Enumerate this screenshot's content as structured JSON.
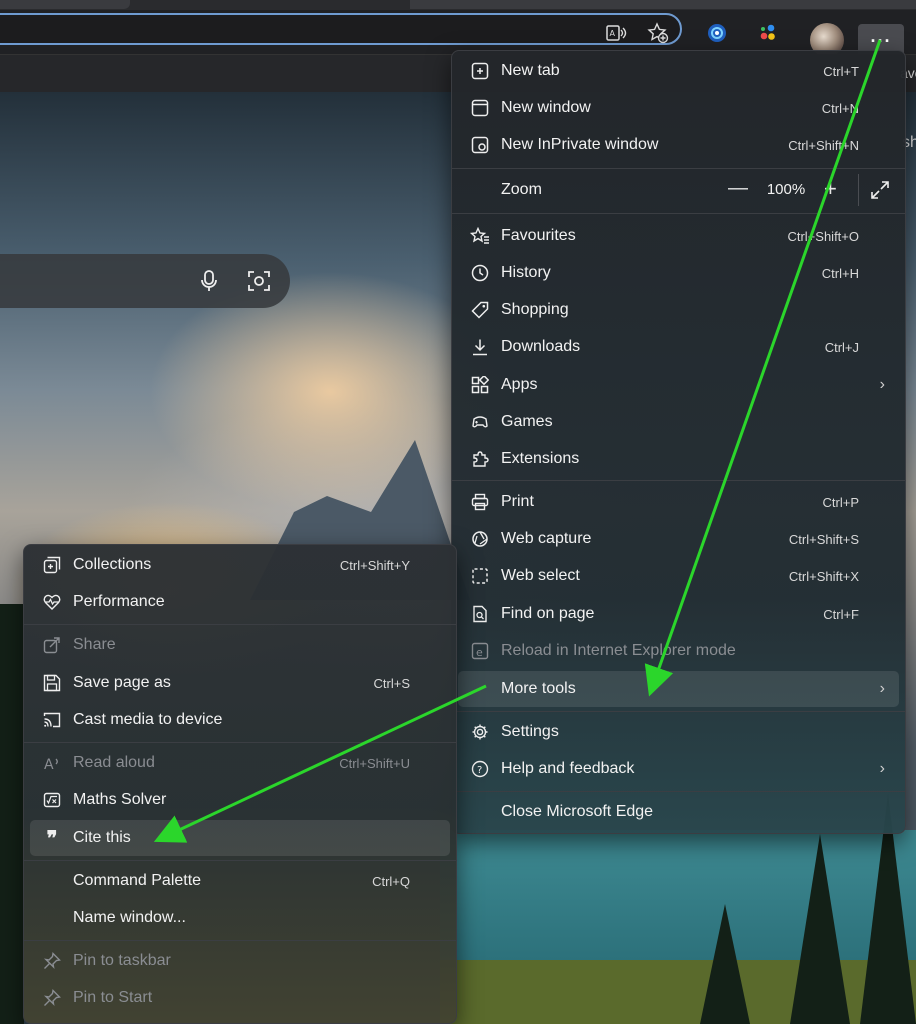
{
  "favourites_bar": {
    "partial_text": "avo"
  },
  "toolbar": {
    "more_label": "···",
    "icons": [
      "read-aloud-icon",
      "add-favourite-icon",
      "copilot-icon",
      "extensions-icon"
    ]
  },
  "page": {
    "search_icons": [
      "microphone-icon",
      "visual-search-icon"
    ],
    "right_edge_text": "sh"
  },
  "main_menu": {
    "new_tab": {
      "label": "New tab",
      "shortcut": "Ctrl+T"
    },
    "new_window": {
      "label": "New window",
      "shortcut": "Ctrl+N"
    },
    "new_inprivate": {
      "label": "New InPrivate window",
      "shortcut": "Ctrl+Shift+N"
    },
    "zoom": {
      "label": "Zoom",
      "minus": "—",
      "value": "100%",
      "plus": "+"
    },
    "favourites": {
      "label": "Favourites",
      "shortcut": "Ctrl+Shift+O"
    },
    "history": {
      "label": "History",
      "shortcut": "Ctrl+H"
    },
    "shopping": {
      "label": "Shopping"
    },
    "downloads": {
      "label": "Downloads",
      "shortcut": "Ctrl+J"
    },
    "apps": {
      "label": "Apps"
    },
    "games": {
      "label": "Games"
    },
    "extensions": {
      "label": "Extensions"
    },
    "print": {
      "label": "Print",
      "shortcut": "Ctrl+P"
    },
    "web_capture": {
      "label": "Web capture",
      "shortcut": "Ctrl+Shift+S"
    },
    "web_select": {
      "label": "Web select",
      "shortcut": "Ctrl+Shift+X"
    },
    "find_on_page": {
      "label": "Find on page",
      "shortcut": "Ctrl+F"
    },
    "reload_ie": {
      "label": "Reload in Internet Explorer mode"
    },
    "more_tools": {
      "label": "More tools"
    },
    "settings": {
      "label": "Settings"
    },
    "help_feedback": {
      "label": "Help and feedback"
    },
    "close_edge": {
      "label": "Close Microsoft Edge"
    }
  },
  "sub_menu": {
    "collections": {
      "label": "Collections",
      "shortcut": "Ctrl+Shift+Y"
    },
    "performance": {
      "label": "Performance"
    },
    "share": {
      "label": "Share"
    },
    "save_page_as": {
      "label": "Save page as",
      "shortcut": "Ctrl+S"
    },
    "cast_media": {
      "label": "Cast media to device"
    },
    "read_aloud": {
      "label": "Read aloud",
      "shortcut": "Ctrl+Shift+U"
    },
    "maths_solver": {
      "label": "Maths Solver"
    },
    "cite_this": {
      "label": "Cite this"
    },
    "command_palette": {
      "label": "Command Palette",
      "shortcut": "Ctrl+Q"
    },
    "name_window": {
      "label": "Name window..."
    },
    "pin_taskbar": {
      "label": "Pin to taskbar"
    },
    "pin_start": {
      "label": "Pin to Start"
    }
  },
  "colors": {
    "menu_bg": "#25282c",
    "address_border": "#6f9bd1",
    "annotation_arrow": "#2bd62b",
    "disabled_text": "#8a8d92"
  }
}
